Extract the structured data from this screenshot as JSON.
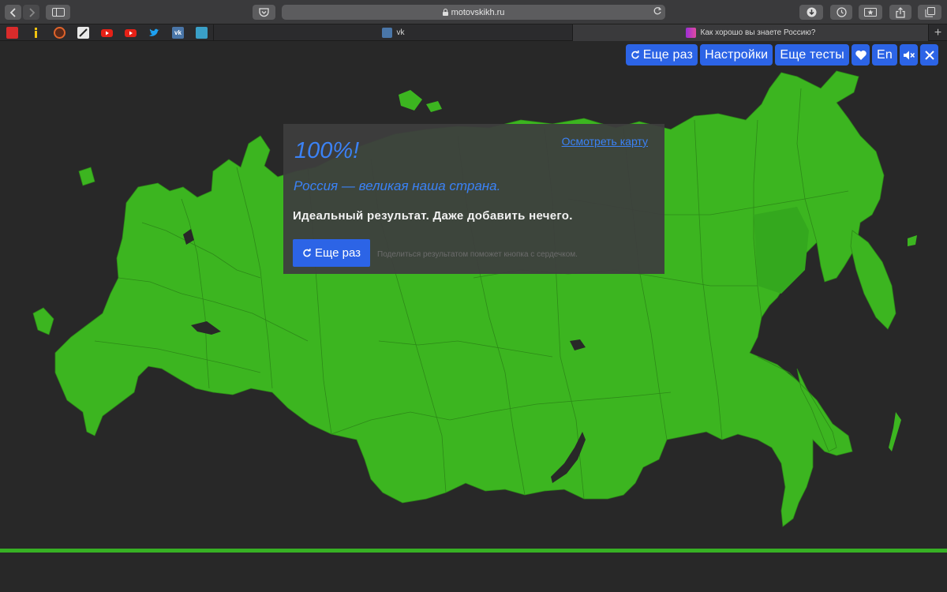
{
  "browser": {
    "address": "motovskikh.ru",
    "tabs": [
      {
        "label": "vk",
        "active": false
      },
      {
        "label": "Как хорошо вы знаете Россию?",
        "active": true
      }
    ],
    "favorites": [
      {
        "icon": "favorite-red-icon",
        "color": "#d92b2b"
      },
      {
        "icon": "favorite-info-icon",
        "color": "#f1c40f"
      },
      {
        "icon": "favorite-orange-icon",
        "color": "#e0632a"
      },
      {
        "icon": "favorite-pen-icon",
        "color": "#e9e9e9"
      },
      {
        "icon": "youtube-icon",
        "color": "#e62117"
      },
      {
        "icon": "youtube-icon",
        "color": "#e62117"
      },
      {
        "icon": "twitter-icon",
        "color": "#1da1f2"
      },
      {
        "icon": "vk-icon",
        "color": "#4a76a8"
      },
      {
        "icon": "favorite-teal-icon",
        "color": "#3aa0c8"
      }
    ]
  },
  "top_buttons": {
    "retry": "Еще раз",
    "settings": "Настройки",
    "more_tests": "Еще тесты",
    "language": "En",
    "like_icon": "heart-icon",
    "mute_icon": "mute-icon",
    "close_icon": "close-icon"
  },
  "result": {
    "score": "100%!",
    "view_map_link": "Осмотреть карту",
    "motto": "Россия — великая наша страна.",
    "message": "Идеальный результат. Даже добавить нечего.",
    "retry_button": "Еще раз",
    "share_hint": "Поделиться результатом поможет кнопка с сердечком."
  },
  "colors": {
    "map_fill": "#3cb520",
    "map_borders": "#2d8a18",
    "accent_blue": "#2c64e6",
    "page_background": "#282828"
  }
}
